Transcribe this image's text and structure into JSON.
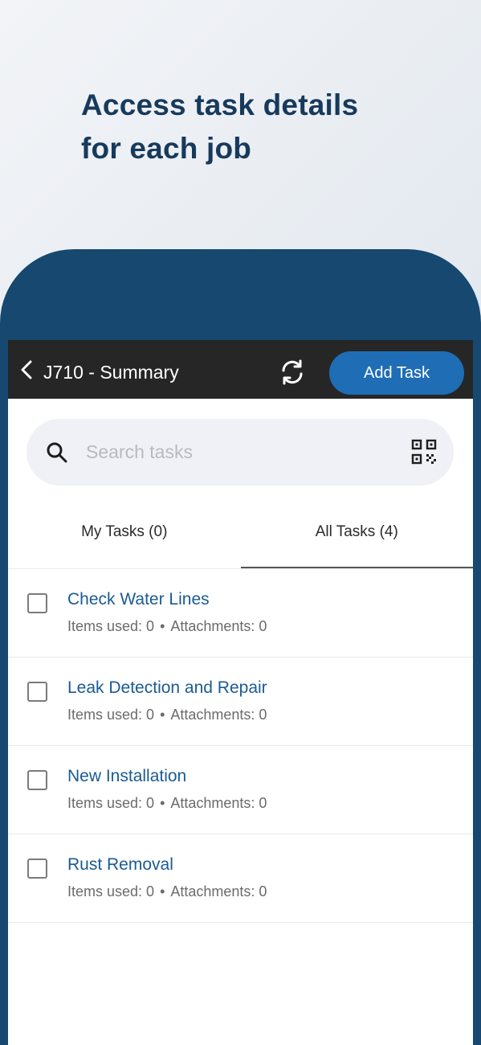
{
  "promo": {
    "line1": "Access task details",
    "line2": "for each job"
  },
  "header": {
    "title": "J710 - Summary",
    "add_task_label": "Add Task",
    "back_icon": "chevron-left-icon",
    "refresh_icon": "refresh-icon"
  },
  "search": {
    "placeholder": "Search tasks",
    "value": "",
    "scan_icon": "qr-code-icon"
  },
  "tabs": [
    {
      "label": "My Tasks (0)",
      "active": false
    },
    {
      "label": "All Tasks (4)",
      "active": true
    }
  ],
  "tasks": [
    {
      "name": "Check Water Lines",
      "items_used": "Items used: 0",
      "separator": "•",
      "attachments": "Attachments: 0"
    },
    {
      "name": "Leak Detection and Repair",
      "items_used": "Items used: 0",
      "separator": "•",
      "attachments": "Attachments: 0"
    },
    {
      "name": "New Installation",
      "items_used": "Items used: 0",
      "separator": "•",
      "attachments": "Attachments: 0"
    },
    {
      "name": "Rust Removal",
      "items_used": "Items used: 0",
      "separator": "•",
      "attachments": "Attachments: 0"
    }
  ],
  "colors": {
    "frame": "#164870",
    "app_bar": "#262626",
    "accent": "#1f6db5",
    "task_link": "#1a5b93",
    "headline": "#173a5c"
  }
}
